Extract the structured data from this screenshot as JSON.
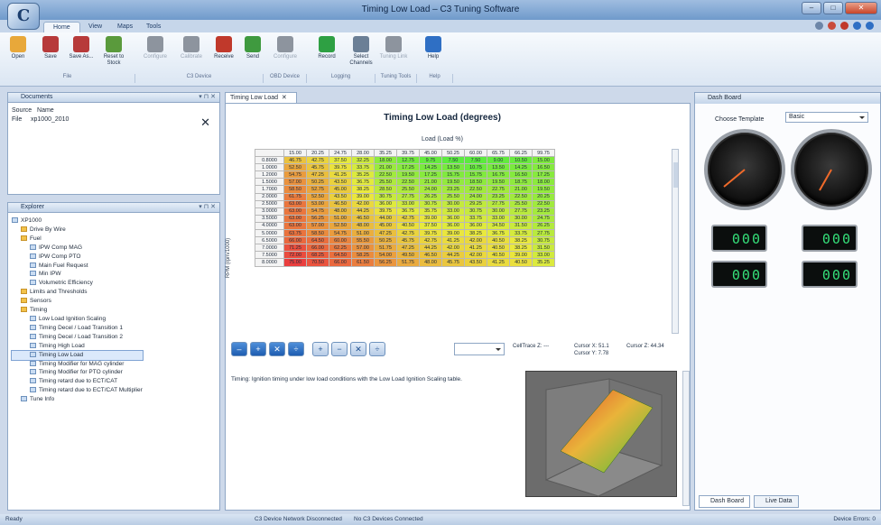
{
  "app": {
    "title": "Timing Low Load – C3 Tuning Software",
    "logo": "C"
  },
  "window_controls": [
    "–",
    "□",
    "✕"
  ],
  "tabs": [
    {
      "label": "Home"
    },
    {
      "label": "View"
    },
    {
      "label": "Maps"
    },
    {
      "label": "Tools"
    }
  ],
  "ribbon": {
    "buttons": [
      {
        "label": "Open",
        "icon": "folder-open-icon",
        "color": "#e8a83a",
        "enabled": true
      },
      {
        "label": "Save",
        "icon": "save-icon",
        "color": "#b73a3a",
        "enabled": true
      },
      {
        "label": "Save As...",
        "icon": "save-as-icon",
        "color": "#b73a3a",
        "enabled": true
      },
      {
        "label": "Reset to Stock",
        "icon": "reset-icon",
        "color": "#5a9a3c",
        "enabled": true
      },
      {
        "label": "Configure",
        "icon": "wrench-icon",
        "color": "#8d949e",
        "enabled": false
      },
      {
        "label": "Calibrate",
        "icon": "gear-icon",
        "color": "#8d949e",
        "enabled": false
      },
      {
        "label": "Receive",
        "icon": "receive-icon",
        "color": "#c0392b",
        "enabled": true
      },
      {
        "label": "Send",
        "icon": "send-icon",
        "color": "#3f9a3f",
        "enabled": true
      },
      {
        "label": "Configure",
        "icon": "device-config-icon",
        "color": "#8d949e",
        "enabled": false
      },
      {
        "label": "Record",
        "icon": "record-icon",
        "color": "#2ea043",
        "enabled": true
      },
      {
        "label": "Select Channels",
        "icon": "channels-icon",
        "color": "#6b7f96",
        "enabled": true
      },
      {
        "label": "Tuning Link",
        "icon": "link-icon",
        "color": "#8d949e",
        "enabled": false
      },
      {
        "label": "Help",
        "icon": "help-icon",
        "color": "#2f6fc4",
        "enabled": true
      }
    ],
    "groups": [
      "File",
      "C3 Device",
      "OBD Device",
      "Logging",
      "Tuning Tools",
      "Help"
    ]
  },
  "documents_panel": {
    "title": "Documents",
    "columns": {
      "source": "Source",
      "name": "Name"
    },
    "row": {
      "source": "File",
      "name": "xp1000_2010"
    }
  },
  "explorer": {
    "title": "Explorer",
    "items": [
      {
        "label": "XP1000",
        "depth": 0,
        "type": "root"
      },
      {
        "label": "Drive By Wire",
        "depth": 1,
        "type": "folder"
      },
      {
        "label": "Fuel",
        "depth": 1,
        "type": "folder"
      },
      {
        "label": "IPW Comp MAG",
        "depth": 2,
        "type": "page"
      },
      {
        "label": "IPW Comp PTO",
        "depth": 2,
        "type": "page"
      },
      {
        "label": "Main Fuel Request",
        "depth": 2,
        "type": "page"
      },
      {
        "label": "Min IPW",
        "depth": 2,
        "type": "page"
      },
      {
        "label": "Volumetric Efficiency",
        "depth": 2,
        "type": "page"
      },
      {
        "label": "Limits and Thresholds",
        "depth": 1,
        "type": "folder"
      },
      {
        "label": "Sensors",
        "depth": 1,
        "type": "folder"
      },
      {
        "label": "Timing",
        "depth": 1,
        "type": "folder"
      },
      {
        "label": "Low Load Ignition Scaling",
        "depth": 2,
        "type": "page"
      },
      {
        "label": "Timing Decel / Load Transition 1",
        "depth": 2,
        "type": "page"
      },
      {
        "label": "Timing Decel / Load Transition 2",
        "depth": 2,
        "type": "page"
      },
      {
        "label": "Timing High Load",
        "depth": 2,
        "type": "page"
      },
      {
        "label": "Timing Low Load",
        "depth": 2,
        "type": "page",
        "selected": true
      },
      {
        "label": "Timing Modifier for MAG cylinder",
        "depth": 2,
        "type": "page"
      },
      {
        "label": "Timing Modifier for PTO cylinder",
        "depth": 2,
        "type": "page"
      },
      {
        "label": "Timing retard due to ECT/CAT",
        "depth": 2,
        "type": "page"
      },
      {
        "label": "Timing retard due to ECT/CAT Multiplier",
        "depth": 2,
        "type": "page"
      },
      {
        "label": "Tune Info",
        "depth": 1,
        "type": "info"
      }
    ]
  },
  "doc_tab": {
    "label": "Timing Low Load"
  },
  "grid": {
    "title": "Timing Low Load (degrees)",
    "x_label": "Load (Load %)",
    "y_label": "RPM (rpm/1000)",
    "columns": [
      "15.00",
      "20.25",
      "24.75",
      "28.00",
      "35.25",
      "39.75",
      "45.00",
      "50.25",
      "60.00",
      "65.75",
      "66.25",
      "99.75"
    ],
    "rows": [
      {
        "rpm": "0.8000",
        "vals": [
          "46.75",
          "42.75",
          "37.50",
          "32.25",
          "18.00",
          "12.75",
          "9.75",
          "7.50",
          "7.50",
          "9.00",
          "10.50",
          "15.00"
        ]
      },
      {
        "rpm": "1.0000",
        "vals": [
          "52.50",
          "45.75",
          "39.75",
          "33.75",
          "21.00",
          "17.25",
          "14.25",
          "13.50",
          "10.75",
          "13.50",
          "14.25",
          "16.50"
        ]
      },
      {
        "rpm": "1.2000",
        "vals": [
          "54.75",
          "47.25",
          "41.25",
          "35.25",
          "22.50",
          "19.50",
          "17.25",
          "15.75",
          "15.75",
          "16.75",
          "16.50",
          "17.25"
        ]
      },
      {
        "rpm": "1.5000",
        "vals": [
          "57.00",
          "50.25",
          "43.50",
          "36.75",
          "25.50",
          "22.50",
          "21.00",
          "19.50",
          "18.50",
          "19.50",
          "18.75",
          "18.00"
        ]
      },
      {
        "rpm": "1.7000",
        "vals": [
          "58.50",
          "52.75",
          "45.00",
          "38.25",
          "28.50",
          "25.50",
          "24.00",
          "23.25",
          "22.50",
          "22.75",
          "21.00",
          "19.50"
        ]
      },
      {
        "rpm": "2.0000",
        "vals": [
          "61.75",
          "52.50",
          "43.50",
          "39.00",
          "30.75",
          "27.75",
          "26.25",
          "25.50",
          "24.00",
          "23.25",
          "22.50",
          "20.25"
        ]
      },
      {
        "rpm": "2.5000",
        "vals": [
          "63.00",
          "53.00",
          "46.50",
          "42.00",
          "36.00",
          "33.00",
          "30.75",
          "30.00",
          "29.25",
          "27.75",
          "25.50",
          "22.50"
        ]
      },
      {
        "rpm": "3.0000",
        "vals": [
          "63.00",
          "54.75",
          "48.00",
          "44.25",
          "39.75",
          "36.75",
          "35.75",
          "33.00",
          "30.75",
          "30.00",
          "27.75",
          "23.25"
        ]
      },
      {
        "rpm": "3.5000",
        "vals": [
          "63.00",
          "56.25",
          "51.00",
          "46.50",
          "44.00",
          "42.75",
          "39.00",
          "36.00",
          "33.75",
          "33.00",
          "30.00",
          "24.75"
        ]
      },
      {
        "rpm": "4.0000",
        "vals": [
          "63.00",
          "57.00",
          "52.50",
          "48.00",
          "45.00",
          "40.50",
          "37.50",
          "36.00",
          "36.00",
          "34.50",
          "31.50",
          "26.25"
        ]
      },
      {
        "rpm": "5.0000",
        "vals": [
          "63.75",
          "58.50",
          "54.75",
          "51.00",
          "47.25",
          "42.75",
          "39.75",
          "39.00",
          "38.25",
          "36.75",
          "33.75",
          "27.75"
        ]
      },
      {
        "rpm": "6.5000",
        "vals": [
          "66.00",
          "64.50",
          "60.00",
          "55.50",
          "50.25",
          "45.75",
          "42.75",
          "41.25",
          "42.00",
          "40.50",
          "38.25",
          "30.75"
        ]
      },
      {
        "rpm": "7.0000",
        "vals": [
          "71.25",
          "66.00",
          "62.25",
          "57.00",
          "51.75",
          "47.25",
          "44.25",
          "42.00",
          "41.25",
          "40.50",
          "38.25",
          "31.50"
        ]
      },
      {
        "rpm": "7.5000",
        "vals": [
          "72.00",
          "68.25",
          "64.50",
          "58.25",
          "54.00",
          "49.50",
          "46.50",
          "44.25",
          "42.00",
          "40.50",
          "39.00",
          "33.00"
        ]
      },
      {
        "rpm": "8.0000",
        "vals": [
          "75.00",
          "70.50",
          "66.00",
          "61.50",
          "56.25",
          "51.75",
          "48.00",
          "45.75",
          "43.50",
          "41.25",
          "40.50",
          "35.25"
        ]
      }
    ]
  },
  "tool_buttons": [
    "–",
    "+",
    "✕",
    "÷",
    "+",
    "−",
    "✕",
    "÷"
  ],
  "cell_info": {
    "cellzscale": "CellTrace Z: ---",
    "cursor_x": "Cursor X: 51.1",
    "cursor_y": "Cursor Y: 7.78",
    "cursor_z": "Cursor Z: 44.34"
  },
  "description": "Timing: Ignition timing under low load conditions with the Low Load Ignition Scaling table.",
  "dashboard": {
    "title": "Dash Board",
    "template_label": "Choose Template",
    "template_value": "Basic",
    "digital_value": "000",
    "tabs": [
      "Dash Board",
      "Live Data"
    ]
  },
  "status": {
    "left": "Ready",
    "network": "C3 Device Network Disconnected",
    "devices": "No C3 Devices Connected",
    "right": "Device Errors: 0"
  }
}
